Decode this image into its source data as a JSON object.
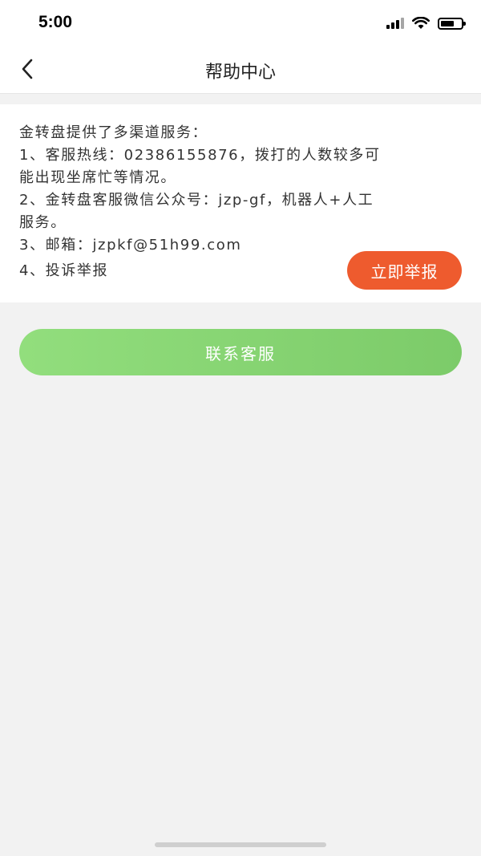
{
  "status_bar": {
    "time": "5:00",
    "battery_level": 0.65
  },
  "nav": {
    "title": "帮助中心",
    "back_icon": "chevron-left-icon"
  },
  "info": {
    "lines": [
      "金转盘提供了多渠道服务：",
      "1、客服热线：02386155876，拨打的人数较多可",
      "能出现坐席忙等情况。",
      "2、金转盘客服微信公众号：jzp-gf，机器人+人工",
      "服务。",
      "3、邮箱：jzpkf@51h99.com",
      "4、投诉举报"
    ],
    "report_button": "立即举报"
  },
  "contact_button": "联系客服",
  "colors": {
    "report": "#ee5b2e",
    "contact_start": "#92de7d",
    "contact_end": "#7ccb69"
  }
}
